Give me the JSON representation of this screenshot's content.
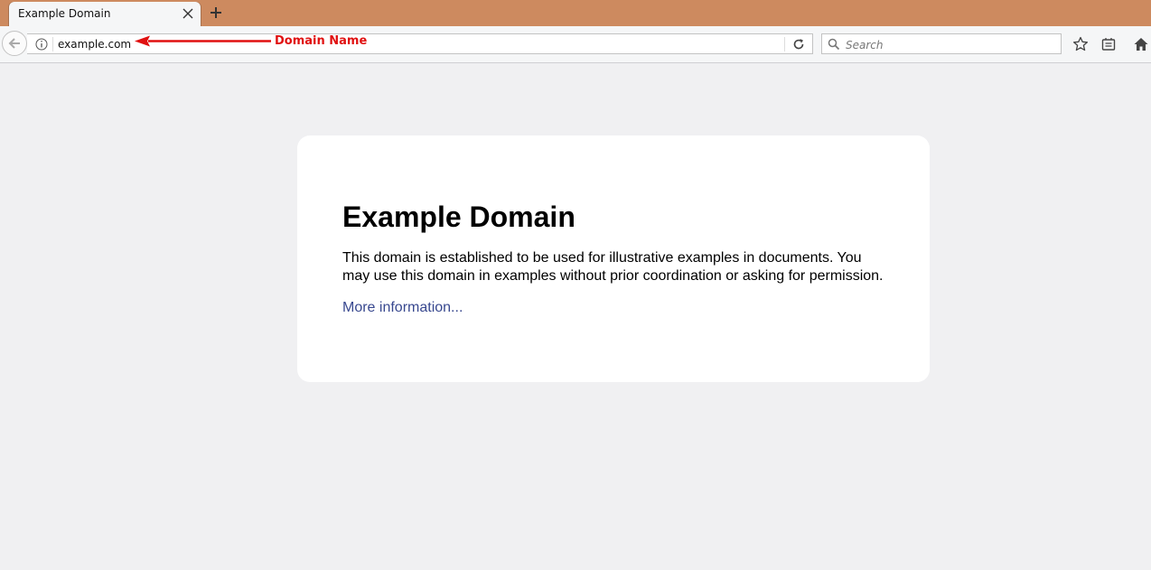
{
  "browser": {
    "tab": {
      "title": "Example Domain"
    },
    "url": "example.com",
    "search": {
      "placeholder": "Search"
    }
  },
  "annotation": {
    "label": "Domain Name",
    "color": "#e01010"
  },
  "page": {
    "heading": "Example Domain",
    "paragraph": "This domain is established to be used for illustrative examples in documents. You may use this domain in examples without prior coordination or asking for permission.",
    "link": "More information..."
  },
  "colors": {
    "tabstrip": "#cd8a5f",
    "page_background": "#f0f0f2",
    "link": "#38488f"
  }
}
